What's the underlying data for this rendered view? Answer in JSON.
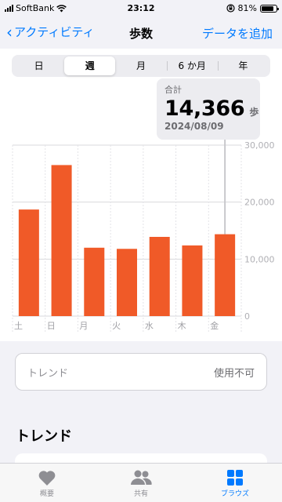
{
  "status_bar": {
    "carrier": "SoftBank",
    "time": "23:12",
    "battery": "81%",
    "battery_level": 0.81,
    "icons": [
      "signal-icon",
      "wifi-icon",
      "orientation-lock-icon",
      "battery-icon"
    ]
  },
  "nav": {
    "back_label": "アクティビティ",
    "title": "歩数",
    "action_label": "データを追加"
  },
  "range_tabs": [
    {
      "label": "日",
      "active": false
    },
    {
      "label": "週",
      "active": true
    },
    {
      "label": "月",
      "active": false
    },
    {
      "label": "6 か月",
      "active": false
    },
    {
      "label": "年",
      "active": false
    }
  ],
  "summary": {
    "label": "合計",
    "value": "14,366",
    "unit": "歩",
    "date": "2024/08/09"
  },
  "chart_data": {
    "type": "bar",
    "categories": [
      "土",
      "日",
      "月",
      "火",
      "水",
      "木",
      "金"
    ],
    "values": [
      18700,
      26500,
      12000,
      11800,
      13900,
      12400,
      14366
    ],
    "ylim": [
      0,
      30000
    ],
    "ytick_labels": [
      "30,000",
      "20,000",
      "10,000",
      "0"
    ],
    "yticks": [
      30000,
      20000,
      10000,
      0
    ],
    "highlighted_index": 6,
    "grid": true,
    "bar_color": "#f05a28"
  },
  "trend_card": {
    "label": "トレンド",
    "status": "使用不可"
  },
  "section_title": "トレンド",
  "tab_bar": [
    {
      "label": "概要",
      "icon": "heart-icon",
      "active": false
    },
    {
      "label": "共有",
      "icon": "people-icon",
      "active": false
    },
    {
      "label": "ブラウズ",
      "icon": "grid-icon",
      "active": true
    }
  ],
  "colors": {
    "accent": "#007aff",
    "bar": "#f05a28",
    "inactive_tab": "#8e8e93"
  }
}
